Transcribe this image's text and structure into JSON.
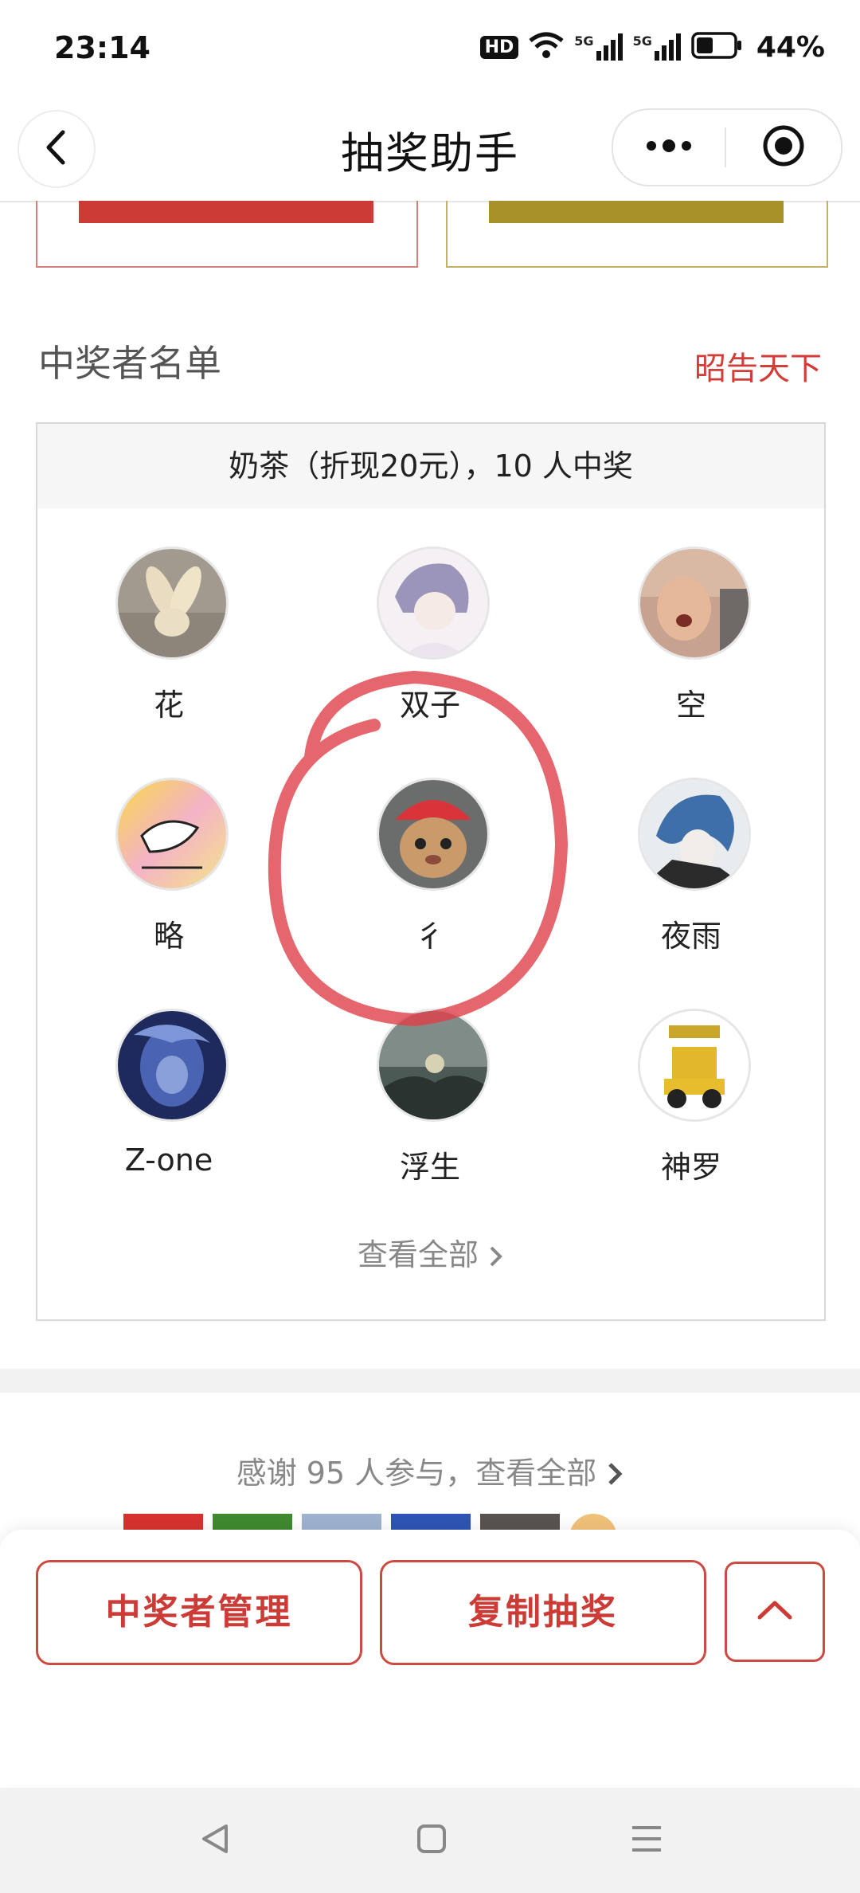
{
  "status_bar": {
    "time": "23:14",
    "network_badge": "HD",
    "signal_labels": [
      "5G",
      "5G"
    ],
    "battery": "44%"
  },
  "nav": {
    "title": "抽奖助手",
    "back_icon": "chevron-left-icon",
    "more_icon": "more-dots-icon",
    "close_icon": "target-circle-icon"
  },
  "winners_section": {
    "title": "中奖者名单",
    "announce_label": "昭告天下",
    "prize_header": "奶茶（折现20元），10 人中奖",
    "winners": [
      {
        "name": "花"
      },
      {
        "name": "双子"
      },
      {
        "name": "空"
      },
      {
        "name": "略"
      },
      {
        "name": "彳"
      },
      {
        "name": "夜雨"
      },
      {
        "name": "Z-one"
      },
      {
        "name": "浮生"
      },
      {
        "name": "神罗"
      }
    ],
    "view_all_label": "查看全部"
  },
  "participants": {
    "thanks_label": "感谢 95 人参与，查看全部"
  },
  "actions": {
    "manage_winners_label": "中奖者管理",
    "copy_lottery_label": "复制抽奖",
    "scroll_top_icon": "chevron-up-icon"
  },
  "colors": {
    "accent_red": "#cc3b36",
    "gold": "#a9912a",
    "annotation_red": "#e0404a"
  }
}
